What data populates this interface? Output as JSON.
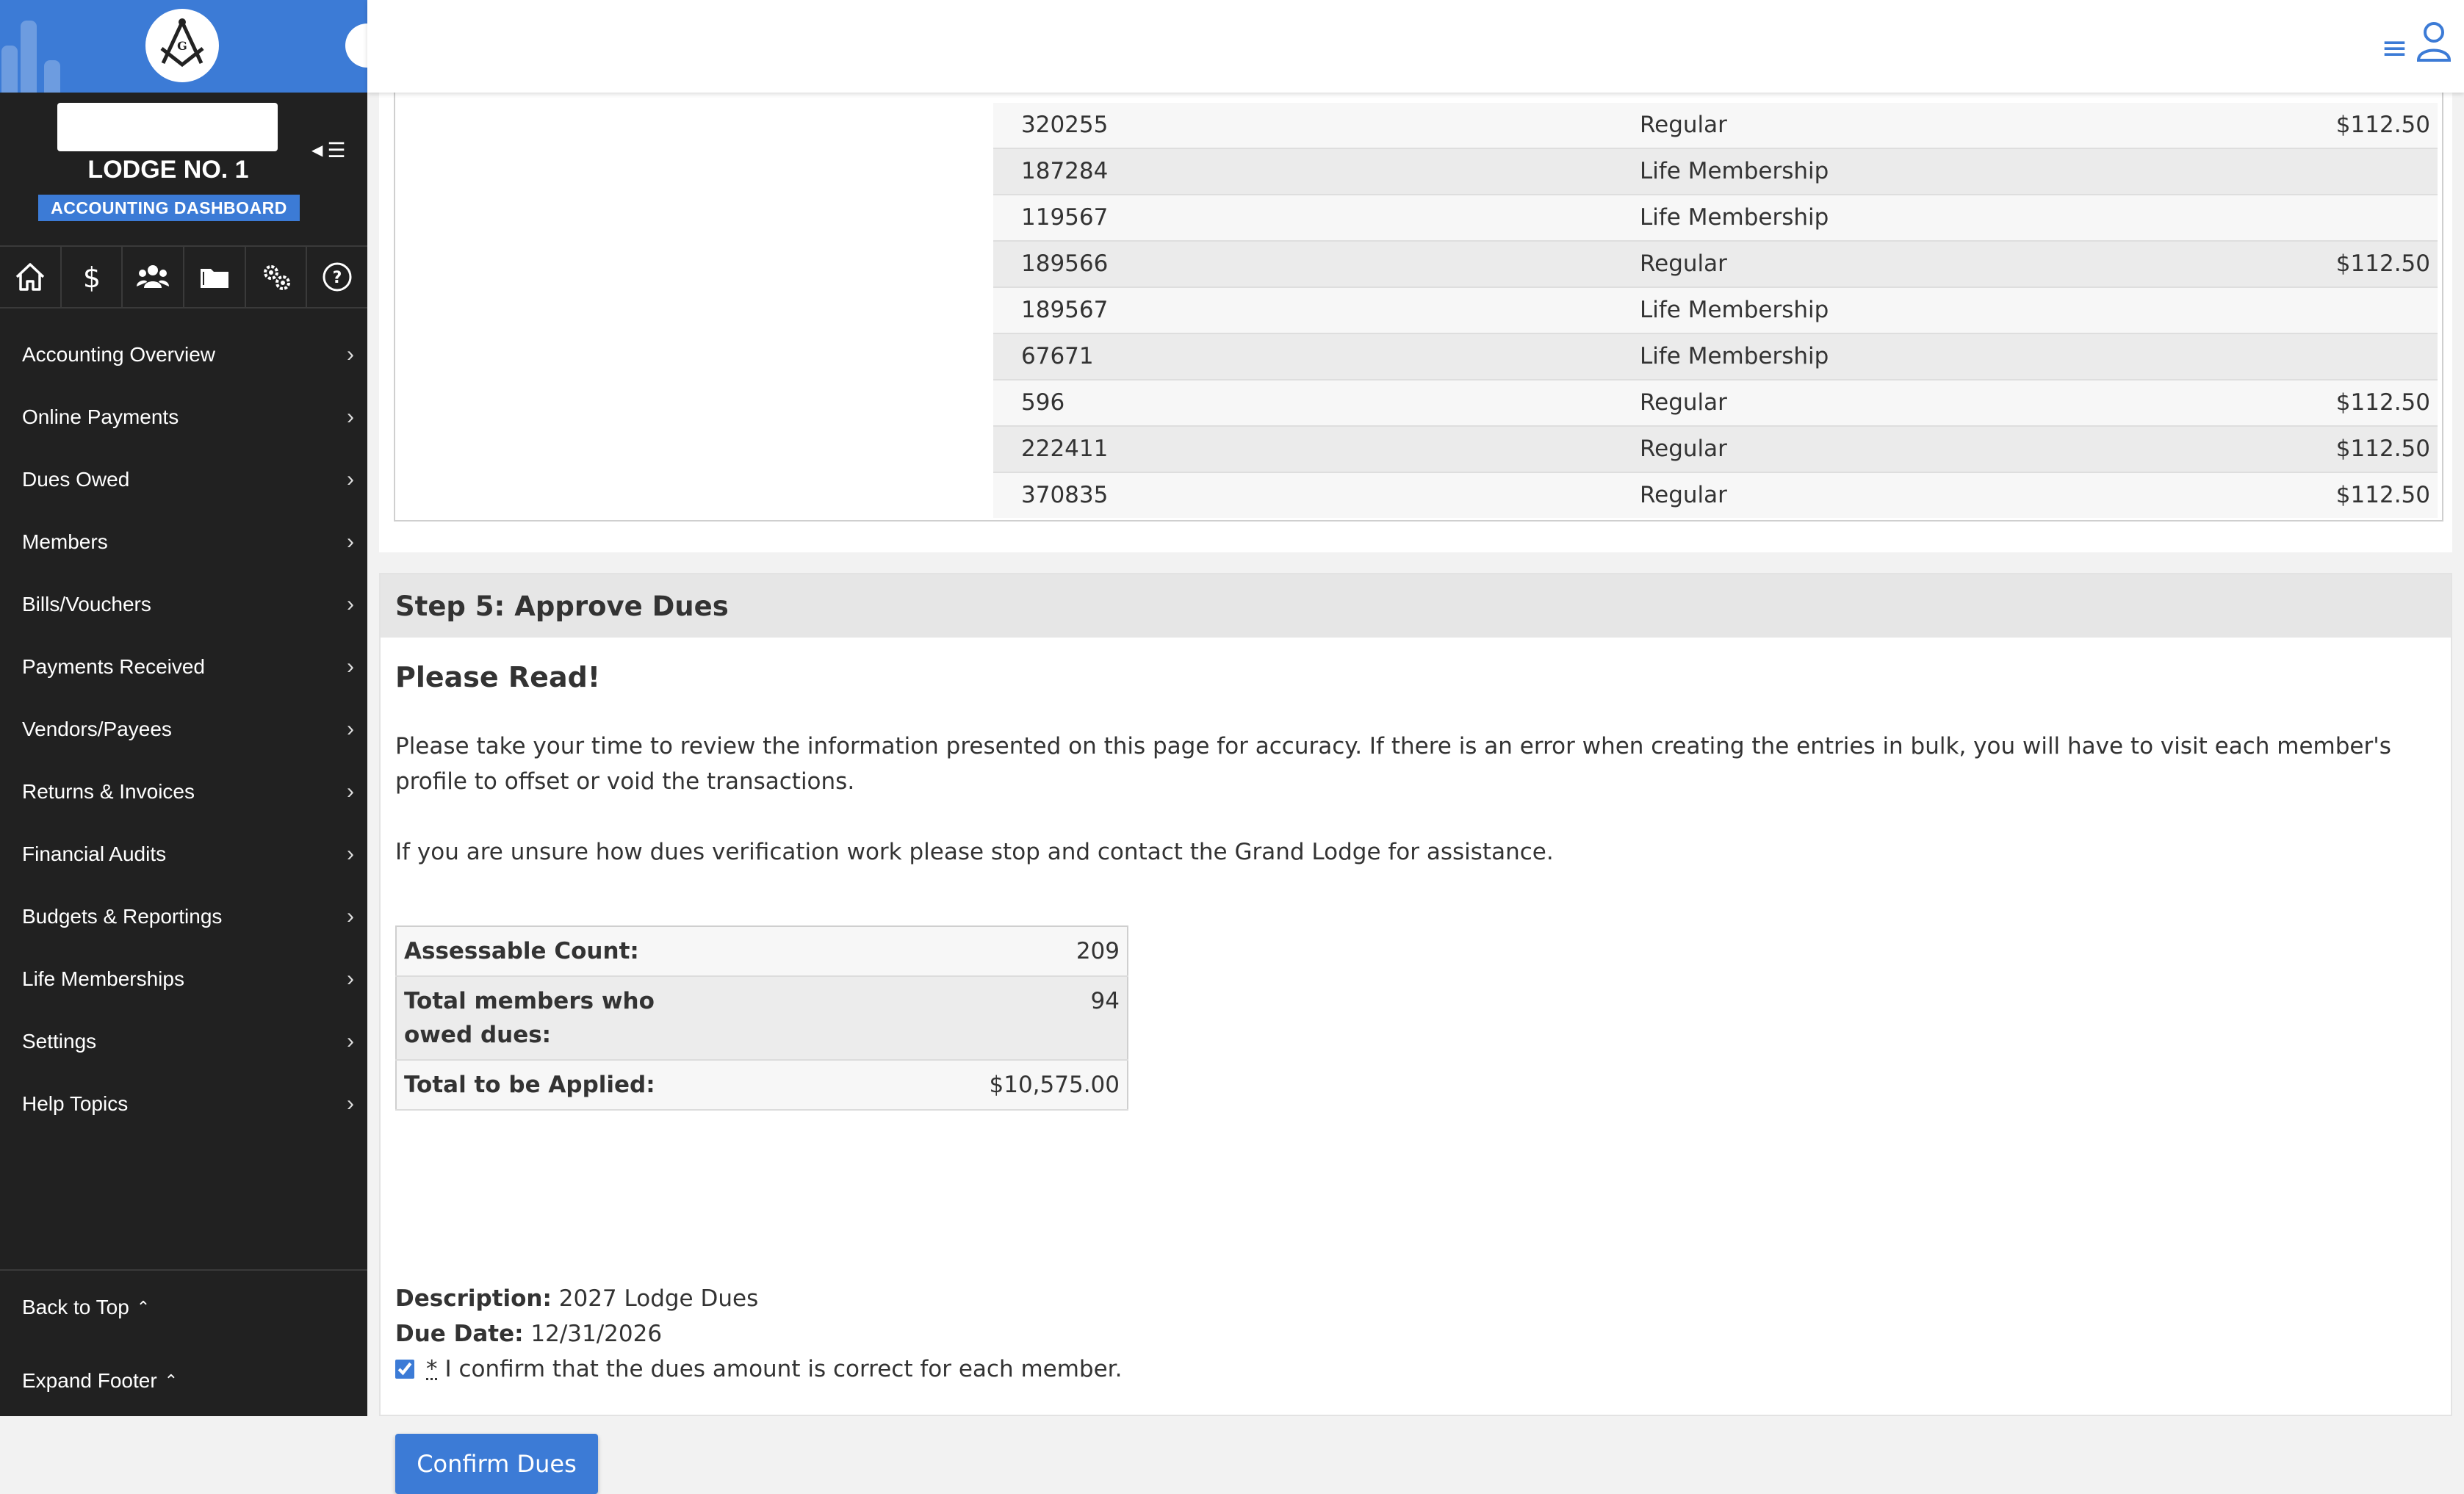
{
  "sidebar": {
    "lodge_name": "LODGE NO. 1",
    "dashboard_badge": "ACCOUNTING DASHBOARD",
    "icons": [
      "home-icon",
      "dollar-icon",
      "members-icon",
      "folder-icon",
      "settings-icon",
      "help-icon"
    ],
    "menu": [
      "Accounting Overview",
      "Online Payments",
      "Dues Owed",
      "Members",
      "Bills/Vouchers",
      "Payments Received",
      "Vendors/Payees",
      "Returns & Invoices",
      "Financial Audits",
      "Budgets & Reportings",
      "Life Memberships",
      "Settings",
      "Help Topics"
    ],
    "back_to_top": "Back to Top",
    "expand_footer": "Expand Footer"
  },
  "members_table": {
    "rows": [
      {
        "id": "320255",
        "type": "Regular",
        "amount": "$112.50"
      },
      {
        "id": "187284",
        "type": "Life Membership",
        "amount": ""
      },
      {
        "id": "119567",
        "type": "Life Membership",
        "amount": ""
      },
      {
        "id": "189566",
        "type": "Regular",
        "amount": "$112.50"
      },
      {
        "id": "189567",
        "type": "Life Membership",
        "amount": ""
      },
      {
        "id": "67671",
        "type": "Life Membership",
        "amount": ""
      },
      {
        "id": "596",
        "type": "Regular",
        "amount": "$112.50"
      },
      {
        "id": "222411",
        "type": "Regular",
        "amount": "$112.50"
      },
      {
        "id": "370835",
        "type": "Regular",
        "amount": "$112.50"
      }
    ]
  },
  "step5": {
    "header": "Step 5: Approve Dues",
    "please_read": "Please Read!",
    "para1": "Please take your time to review the information presented on this page for accuracy. If there is an error when creating the entries in bulk, you will have to visit each member's profile to offset or void the transactions.",
    "para2": "If you are unsure how dues verification work please stop and contact the Grand Lodge for assistance.",
    "summary": {
      "assessable_label": "Assessable Count:",
      "assessable_value": "209",
      "owed_label": "Total members who owed dues:",
      "owed_value": "94",
      "total_label": "Total to be Applied:",
      "total_value": "$10,575.00"
    },
    "description_label": "Description:",
    "description_value": "2027 Lodge Dues",
    "due_date_label": "Due Date:",
    "due_date_value": "12/31/2026",
    "required_marker": "*",
    "confirm_text": "I confirm that the dues amount is correct for each member.",
    "confirm_checked": true,
    "confirm_button": "Confirm Dues"
  },
  "colors": {
    "accent": "#3c7bd6",
    "sidebar_bg": "#212121"
  }
}
